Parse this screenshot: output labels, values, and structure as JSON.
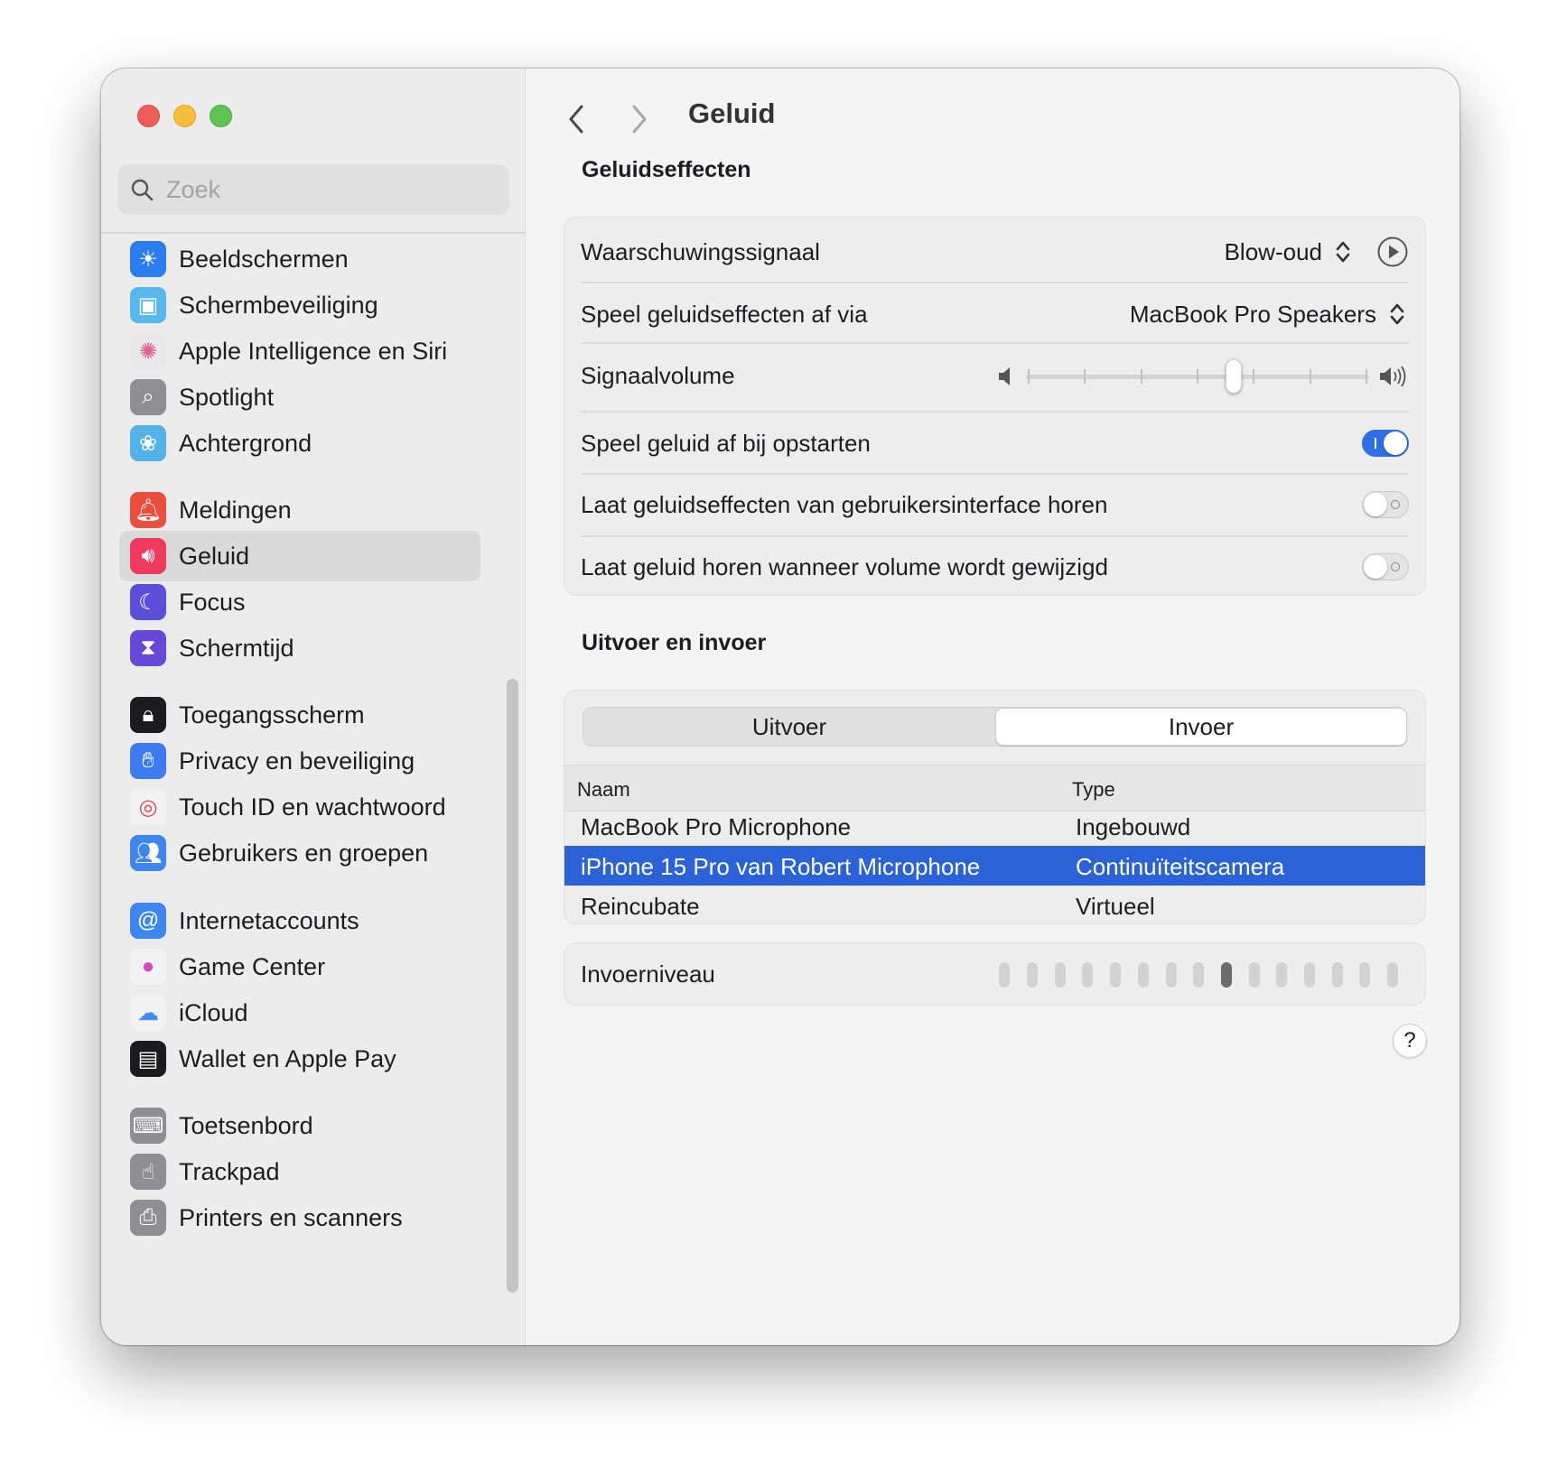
{
  "search": {
    "placeholder": "Zoek"
  },
  "sidebar": {
    "items": [
      {
        "label": "Beeldschermen",
        "icon": "sun-icon",
        "color": "#2b7ef0"
      },
      {
        "label": "Schermbeveiliging",
        "icon": "screensaver-icon",
        "color": "#56b8ec"
      },
      {
        "label": "Apple Intelligence en Siri",
        "icon": "siri-icon",
        "color": "#e8e8e8"
      },
      {
        "label": "Spotlight",
        "icon": "magnifier-icon",
        "color": "#8e8e93"
      },
      {
        "label": "Achtergrond",
        "icon": "flower-icon",
        "color": "#53b3e8"
      },
      {
        "label": "Meldingen",
        "icon": "bell-icon",
        "color": "#eb4e3d"
      },
      {
        "label": "Geluid",
        "icon": "speaker-icon",
        "color": "#ee3b5c"
      },
      {
        "label": "Focus",
        "icon": "moon-icon",
        "color": "#5b4fd9"
      },
      {
        "label": "Schermtijd",
        "icon": "hourglass-icon",
        "color": "#6848d8"
      },
      {
        "label": "Toegangsscherm",
        "icon": "lock-screen-icon",
        "color": "#1c1c1e"
      },
      {
        "label": "Privacy en beveiliging",
        "icon": "hand-icon",
        "color": "#3d7cf0"
      },
      {
        "label": "Touch ID en wachtwoord",
        "icon": "fingerprint-icon",
        "color": "#f2f2f2"
      },
      {
        "label": "Gebruikers en groepen",
        "icon": "users-icon",
        "color": "#3d86f0"
      },
      {
        "label": "Internetaccounts",
        "icon": "at-icon",
        "color": "#3d86f0"
      },
      {
        "label": "Game Center",
        "icon": "game-center-icon",
        "color": "#f2f2f2"
      },
      {
        "label": "iCloud",
        "icon": "cloud-icon",
        "color": "#f2f2f2"
      },
      {
        "label": "Wallet en Apple Pay",
        "icon": "wallet-icon",
        "color": "#1c1c1e"
      },
      {
        "label": "Toetsenbord",
        "icon": "keyboard-icon",
        "color": "#8e8e93"
      },
      {
        "label": "Trackpad",
        "icon": "trackpad-icon",
        "color": "#8e8e93"
      },
      {
        "label": "Printers en scanners",
        "icon": "printer-icon",
        "color": "#8e8e93"
      }
    ],
    "active_index": 6
  },
  "header": {
    "title": "Geluid"
  },
  "sound_effects": {
    "title": "Geluidseffecten",
    "alert_label": "Waarschuwingssignaal",
    "alert_value": "Blow-oud",
    "output_label": "Speel geluidseffecten af via",
    "output_value": "MacBook Pro Speakers",
    "volume_label": "Signaalvolume",
    "volume_level": 0.61,
    "startup_label": "Speel geluid af bij opstarten",
    "startup_on": true,
    "ui_label": "Laat geluidseffecten van gebruikersinterface horen",
    "ui_on": false,
    "feedback_label": "Laat geluid horen wanneer volume wordt gewijzigd",
    "feedback_on": false
  },
  "io": {
    "title": "Uitvoer en invoer",
    "tabs": [
      "Uitvoer",
      "Invoer"
    ],
    "selected_tab": 1,
    "columns": [
      "Naam",
      "Type"
    ],
    "rows": [
      {
        "name": "MacBook Pro Microphone",
        "type": "Ingebouwd"
      },
      {
        "name": "iPhone 15 Pro van Robert Microphone",
        "type": "Continuïteitscamera"
      },
      {
        "name": "Reincubate",
        "type": "Virtueel"
      }
    ],
    "selected_row": 1,
    "level_label": "Invoerniveau",
    "level_active": 9,
    "level_total": 15
  },
  "help": {
    "label": "?"
  },
  "colors": {
    "accent": "#2f6fe6",
    "selection": "#2c62d8"
  }
}
